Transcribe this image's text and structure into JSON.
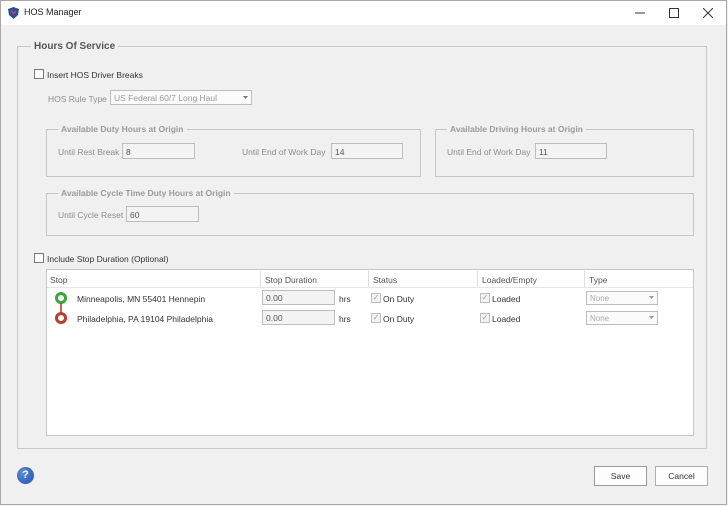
{
  "window": {
    "title": "HOS Manager"
  },
  "hours_of_service": {
    "title": "Hours Of Service",
    "insert_breaks_label": "Insert HOS Driver Breaks",
    "insert_breaks_checked": false,
    "rule_type_label": "HOS Rule Type",
    "rule_type_value": "US Federal 60/7 Long Haul",
    "duty_group": {
      "title": "Available Duty Hours at Origin",
      "until_rest_break_label": "Until Rest Break",
      "until_rest_break_value": "8",
      "until_end_of_work_day_label": "Until End of Work Day",
      "until_end_of_work_day_value": "14"
    },
    "driving_group": {
      "title": "Available Driving Hours at Origin",
      "until_end_of_work_day_label": "Until End of Work Day",
      "until_end_of_work_day_value": "11"
    },
    "cycle_group": {
      "title": "Available Cycle Time Duty Hours at Origin",
      "until_cycle_reset_label": "Until Cycle Reset",
      "until_cycle_reset_value": "60"
    },
    "include_stop_duration_label": "Include Stop Duration (Optional)",
    "include_stop_duration_checked": false
  },
  "table": {
    "columns": [
      "Stop",
      "Stop Duration",
      "Status",
      "Loaded/Empty",
      "Type"
    ],
    "rows": [
      {
        "stop": "Minneapolis, MN 55401 Hennepin",
        "duration": "0.00",
        "unit": "hrs",
        "status": "On Duty",
        "status_checked": true,
        "loaded": "Loaded",
        "loaded_checked": true,
        "type": "None",
        "marker": "origin"
      },
      {
        "stop": "Philadelphia, PA 19104 Philadelphia",
        "duration": "0.00",
        "unit": "hrs",
        "status": "On Duty",
        "status_checked": true,
        "loaded": "Loaded",
        "loaded_checked": true,
        "type": "None",
        "marker": "destination"
      }
    ]
  },
  "buttons": {
    "save": "Save",
    "cancel": "Cancel"
  },
  "icons": {
    "app": "shield-logo-icon",
    "help": "help-icon",
    "minimize": "minimize-icon",
    "maximize": "maximize-icon",
    "close": "close-icon"
  },
  "colors": {
    "origin_marker": "#39a935",
    "destination_marker": "#c0392b"
  }
}
